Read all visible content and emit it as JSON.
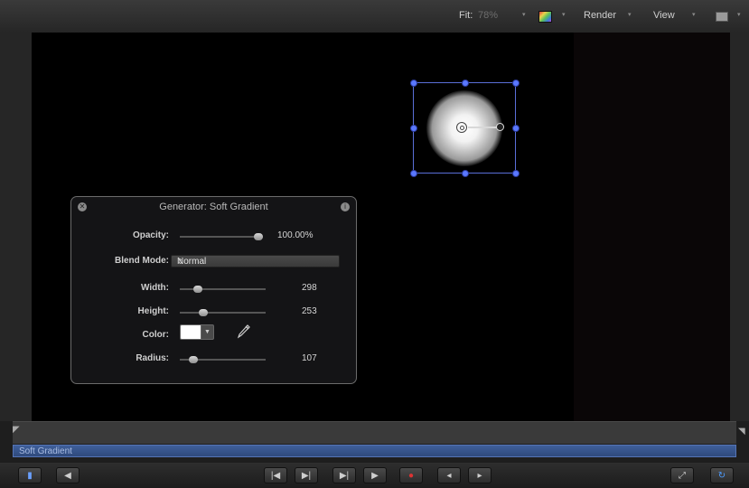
{
  "toolbar": {
    "fit_label": "Fit:",
    "fit_value": "78%",
    "render_label": "Render",
    "view_label": "View",
    "dropdown_caret": "▾",
    "view_icon": "view-layout-icon",
    "color_channels_icon": "color-channels-icon"
  },
  "canvas": {
    "background": "#000000",
    "shape_color": "#ffffff",
    "selection_color": "#5a78ff"
  },
  "hud": {
    "title": "Generator: Soft Gradient",
    "opacity": {
      "label": "Opacity:",
      "value": "100.00%",
      "level": 1.0
    },
    "blend_mode": {
      "label": "Blend Mode:",
      "value": "Normal"
    },
    "width": {
      "label": "Width:",
      "value": "298",
      "level": 0.18
    },
    "height": {
      "label": "Height:",
      "value": "253",
      "level": 0.25
    },
    "color": {
      "label": "Color:",
      "value": "#ffffff"
    },
    "radius": {
      "label": "Radius:",
      "value": "107",
      "level": 0.12
    }
  },
  "timeline": {
    "clip_name": "Soft Gradient"
  },
  "transport": {
    "buttons": [
      "play-range-icon",
      "audio-icon",
      "go-to-start-icon",
      "step-back-icon",
      "step-forward-icon",
      "play-icon",
      "record-icon",
      "prev-keyframe-icon",
      "next-keyframe-icon",
      "fullscreen-icon",
      "loop-icon"
    ]
  }
}
